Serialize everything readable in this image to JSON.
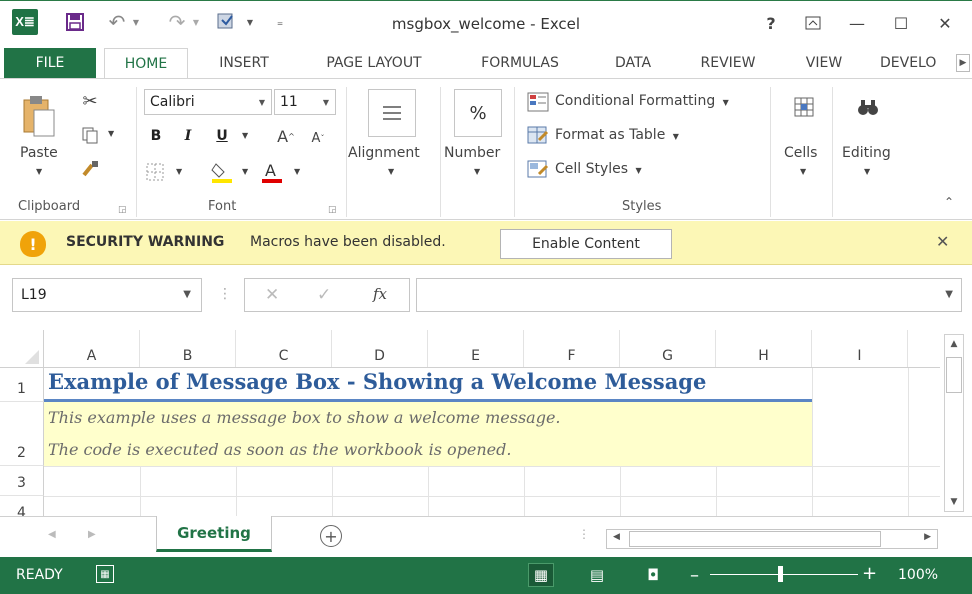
{
  "window": {
    "title": "msgbox_welcome - Excel",
    "help": "?",
    "ribbon_display": "⊼",
    "minimize": "—",
    "maximize": "☐",
    "close": "✕"
  },
  "qat": {
    "logo": "X≣",
    "save_icon": "save-icon",
    "undo": "↶",
    "redo": "↷"
  },
  "tabs": {
    "file": "FILE",
    "items": [
      "HOME",
      "INSERT",
      "PAGE LAYOUT",
      "FORMULAS",
      "DATA",
      "REVIEW",
      "VIEW",
      "DEVELO"
    ],
    "active": "HOME"
  },
  "ribbon": {
    "clipboard": {
      "label": "Clipboard",
      "paste": "Paste"
    },
    "font": {
      "label": "Font",
      "name": "Calibri",
      "size": "11",
      "bold": "B",
      "italic": "I",
      "underline": "U"
    },
    "alignment": {
      "label": "Alignment"
    },
    "number": {
      "label": "Number",
      "symbol": "%"
    },
    "styles": {
      "label": "Styles",
      "conditional": "Conditional Formatting",
      "format_table": "Format as Table",
      "cell_styles": "Cell Styles"
    },
    "cells": {
      "label": "Cells"
    },
    "editing": {
      "label": "Editing"
    }
  },
  "security": {
    "title": "SECURITY WARNING",
    "message": "Macros have been disabled.",
    "button": "Enable Content"
  },
  "formula_bar": {
    "name_box": "L19",
    "fx": "fx",
    "value": ""
  },
  "grid": {
    "columns": [
      "A",
      "B",
      "C",
      "D",
      "E",
      "F",
      "G",
      "H",
      "I"
    ],
    "rows": [
      "1",
      "2",
      "3",
      "4"
    ],
    "title": "Example of Message Box - Showing a Welcome Message",
    "note_line1": "This example uses a message box to show a welcome message.",
    "note_line2": "The code is executed as soon as the workbook is opened."
  },
  "sheets": {
    "active": "Greeting",
    "add": "+"
  },
  "status": {
    "ready": "READY",
    "zoom": "100%",
    "colors": {
      "green": "#217346",
      "title_blue": "#2e5c9a",
      "note_bg": "#ffffcc",
      "warning_bg": "#fcf7b6"
    }
  }
}
